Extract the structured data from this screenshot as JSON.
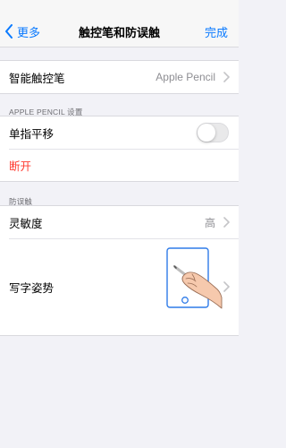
{
  "nav": {
    "back_label": "更多",
    "title": "触控笔和防误触",
    "done_label": "完成"
  },
  "stylus": {
    "label": "智能触控笔",
    "value": "Apple Pencil"
  },
  "apple_pencil_section": {
    "header": "APPLE PENCIL 设置",
    "single_finger_pan_label": "单指平移",
    "single_finger_pan_on": false,
    "disconnect_label": "断开"
  },
  "mistouch_section": {
    "header": "防误触",
    "sensitivity_label": "灵敏度",
    "sensitivity_value": "高",
    "writing_posture_label": "写字姿势"
  },
  "colors": {
    "accent": "#0a7aff",
    "destructive": "#ff3b30",
    "background": "#f2f2f7"
  },
  "icons": [
    "chevron-left-icon",
    "chevron-right-icon",
    "toggle-switch",
    "hand-pencil-illustration"
  ]
}
